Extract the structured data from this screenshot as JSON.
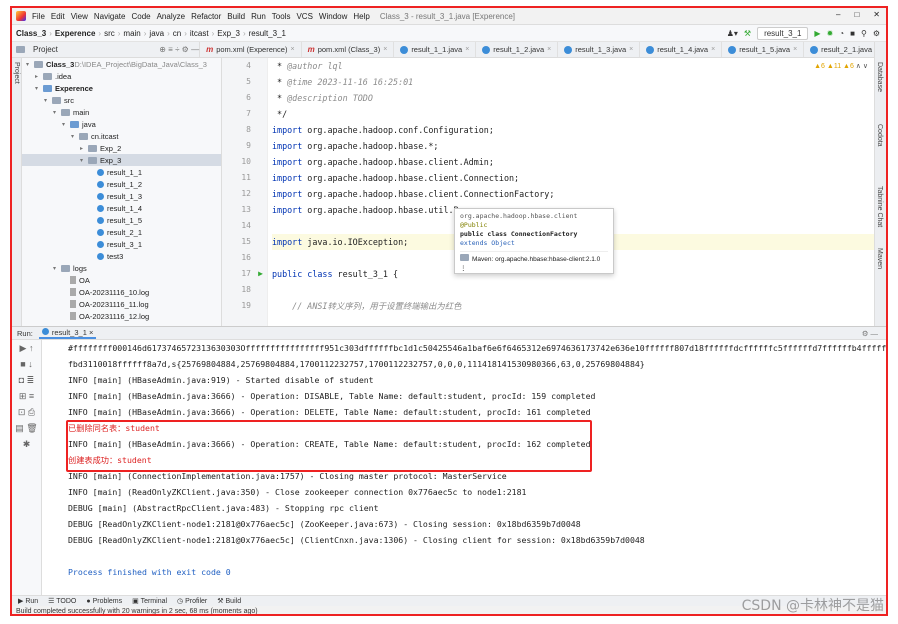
{
  "menu": {
    "items": [
      "File",
      "Edit",
      "View",
      "Navigate",
      "Code",
      "Analyze",
      "Refactor",
      "Build",
      "Run",
      "Tools",
      "VCS",
      "Window",
      "Help"
    ],
    "window_title": "Class_3 - result_3_1.java [Experence]"
  },
  "nav": {
    "crumbs": [
      "Class_3",
      "Experence",
      "src",
      "main",
      "java",
      "cn",
      "itcast",
      "Exp_3",
      "result_3_1"
    ],
    "run_config": "result_3_1"
  },
  "tabs": [
    "pom.xml (Experence)",
    "pom.xml (Class_3)",
    "result_1_1.java",
    "result_1_2.java",
    "result_1_3.java",
    "result_1_4.java",
    "result_1_5.java",
    "result_2_1.java",
    "result_3_1.java"
  ],
  "project": {
    "label": "Project",
    "tree": [
      {
        "t": "Class_3",
        "extra": "D:\\IDEA_Project\\BigData_Java\\Class_3",
        "d": 0,
        "k": "folder",
        "a": "▾",
        "b": true
      },
      {
        "t": ".idea",
        "d": 1,
        "k": "folder",
        "a": "▸"
      },
      {
        "t": "Experence",
        "d": 1,
        "k": "folder blue",
        "a": "▾",
        "b": true
      },
      {
        "t": "src",
        "d": 2,
        "k": "folder",
        "a": "▾"
      },
      {
        "t": "main",
        "d": 3,
        "k": "folder",
        "a": "▾"
      },
      {
        "t": "java",
        "d": 4,
        "k": "folder blue",
        "a": "▾"
      },
      {
        "t": "cn.itcast",
        "d": 5,
        "k": "folder",
        "a": "▾"
      },
      {
        "t": "Exp_2",
        "d": 6,
        "k": "folder",
        "a": "▸"
      },
      {
        "t": "Exp_3",
        "d": 6,
        "k": "folder",
        "a": "▾",
        "sel": true
      },
      {
        "t": "result_1_1",
        "d": 7,
        "k": "java"
      },
      {
        "t": "result_1_2",
        "d": 7,
        "k": "java"
      },
      {
        "t": "result_1_3",
        "d": 7,
        "k": "java"
      },
      {
        "t": "result_1_4",
        "d": 7,
        "k": "java"
      },
      {
        "t": "result_1_5",
        "d": 7,
        "k": "java"
      },
      {
        "t": "result_2_1",
        "d": 7,
        "k": "java"
      },
      {
        "t": "result_3_1",
        "d": 7,
        "k": "java"
      },
      {
        "t": "test3",
        "d": 7,
        "k": "java"
      },
      {
        "t": "logs",
        "d": 3,
        "k": "folder",
        "a": "▾"
      },
      {
        "t": "OA",
        "d": 4,
        "k": "log"
      },
      {
        "t": "OA-20231116_10.log",
        "d": 4,
        "k": "log"
      },
      {
        "t": "OA-20231116_11.log",
        "d": 4,
        "k": "log"
      },
      {
        "t": "OA-20231116_12.log",
        "d": 4,
        "k": "log"
      }
    ]
  },
  "editor": {
    "inspections": "▲6 ▲11 ▲6",
    "lines": [
      {
        "n": "4",
        "c": " * <span class=\"cmt\">@author lql</span>"
      },
      {
        "n": "5",
        "c": " * <span class=\"cmt\">@time 2023-11-16 16:25:01</span>"
      },
      {
        "n": "6",
        "c": " * <span class=\"cmt\">@description TODO</span>"
      },
      {
        "n": "7",
        "c": " */"
      },
      {
        "n": "8",
        "c": "<span class=\"kw\">import</span> org.apache.hadoop.conf.Configuration;"
      },
      {
        "n": "9",
        "c": "<span class=\"kw\">import</span> org.apache.hadoop.hbase.*;"
      },
      {
        "n": "10",
        "c": "<span class=\"kw\">import</span> org.apache.hadoop.hbase.client.Admin;"
      },
      {
        "n": "11",
        "c": "<span class=\"kw\">import</span> org.apache.hadoop.hbase.client.Connection;"
      },
      {
        "n": "12",
        "c": "<span class=\"kw\">import</span> org.apache.hadoop.hbase.client.ConnectionFactory;"
      },
      {
        "n": "13",
        "c": "<span class=\"kw\">import</span> org.apache.hadoop.hbase.util.By"
      },
      {
        "n": "14",
        "c": ""
      },
      {
        "n": "15",
        "c": "<span class=\"kw\">import</span> java.io.IOException;",
        "cur": true
      },
      {
        "n": "16",
        "c": ""
      },
      {
        "n": "17",
        "c": "<span class=\"kw\">public class</span> result_3_1 {",
        "mk": "▶"
      },
      {
        "n": "18",
        "c": ""
      },
      {
        "n": "19",
        "c": "    <span class=\"cmt\">// ANSI转义序列，用于设置终端输出为红色</span>"
      }
    ]
  },
  "popup": {
    "pkg": "org.apache.hadoop.hbase.client",
    "ann": "@Public",
    "decl": "public class ConnectionFactory",
    "ext": "extends Object",
    "maven": "Maven: org.apache.hbase:hbase-client:2.1.0"
  },
  "run": {
    "label": "Run:",
    "tab": "result_3_1",
    "lines": [
      {
        "t": "#ffffffff000146d6173746572313630303Offffffffffffffff951c303dffffffbc1d1c50425546a1baf6e6f6465312e6974636173742e636e10ffffff807d18ffffffdcffffffc5ffffffd7ffffffb4fffff"
      },
      {
        "t": "fbd3110018ffffff8a7d,s{25769804884,25769804884,1700112232757,1700112232757,0,0,0,111418141530980366,63,0,25769804884}"
      },
      {
        "t": "INFO [main] (HBaseAdmin.java:919) - Started disable of student"
      },
      {
        "t": "INFO [main] (HBaseAdmin.java:3666) - Operation: DISABLE, Table Name: default:student, procId: 159 completed"
      },
      {
        "t": "INFO [main] (HBaseAdmin.java:3666) - Operation: DELETE, Table Name: default:student, procId: 161 completed"
      },
      {
        "t": "已删除同名表：student",
        "c": "red"
      },
      {
        "t": "INFO [main] (HBaseAdmin.java:3666) - Operation: CREATE, Table Name: default:student, procId: 162 completed"
      },
      {
        "t": "创建表成功：student",
        "c": "red"
      },
      {
        "t": "INFO [main] (ConnectionImplementation.java:1757) - Closing master protocol: MasterService"
      },
      {
        "t": "INFO [main] (ReadOnlyZKClient.java:350) - Close zookeeper connection 0x776aec5c to node1:2181"
      },
      {
        "t": "DEBUG [main] (AbstractRpcClient.java:483) - Stopping rpc client"
      },
      {
        "t": "DEBUG [ReadOnlyZKClient-node1:2181@0x776aec5c] (ZooKeeper.java:673) - Closing session: 0x18bd6359b7d0048"
      },
      {
        "t": "DEBUG [ReadOnlyZKClient-node1:2181@0x776aec5c] (ClientCnxn.java:1306) - Closing client for session: 0x18bd6359b7d0048"
      },
      {
        "t": ""
      },
      {
        "t": "Process finished with exit code 0",
        "c": "blue"
      }
    ]
  },
  "bottom": {
    "items": [
      "Run",
      "TODO",
      "Problems",
      "Terminal",
      "Profiler",
      "Build"
    ]
  },
  "status": {
    "text": "Build completed successfully with 20 warnings in 2 sec, 68 ms (moments ago)",
    "watermark": "CSDN @卡林神不是猫"
  },
  "right_strip": [
    "Database",
    "Codota",
    "Tabnine Chat",
    "Maven"
  ]
}
